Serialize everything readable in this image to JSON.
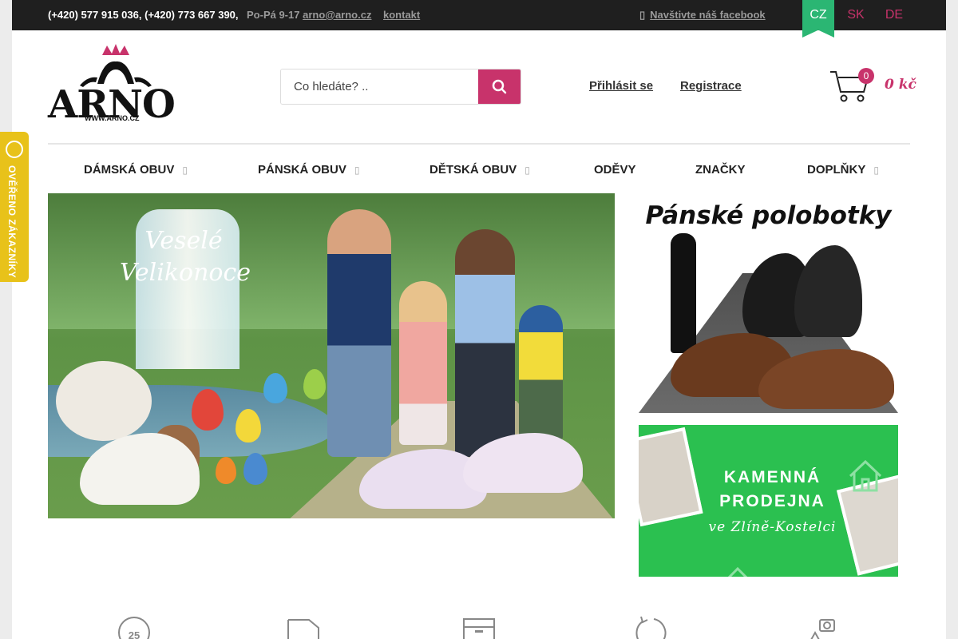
{
  "topbar": {
    "phones": "(+420) 577 915 036, (+420) 773 667 390,",
    "hours": "Po-Pá 9-17",
    "email": "arno@arno.cz",
    "contact": "kontakt",
    "facebook_icon": "facebook-icon",
    "facebook": "Navštivte náš facebook",
    "languages": [
      "CZ",
      "SK",
      "DE"
    ],
    "active_language": "CZ"
  },
  "header": {
    "logo_text": "ARNO",
    "logo_url": "WWW.ARNO.CZ",
    "search_placeholder": "Co hledáte? ..",
    "login": "Přihlásit se",
    "register": "Registrace",
    "cart_count": "0",
    "cart_total": "0 kč"
  },
  "nav": {
    "items": [
      {
        "label": "DÁMSKÁ OBUV",
        "has_submenu": true
      },
      {
        "label": "PÁNSKÁ OBUV",
        "has_submenu": true
      },
      {
        "label": "DĚTSKÁ OBUV",
        "has_submenu": true
      },
      {
        "label": "ODĚVY",
        "has_submenu": false
      },
      {
        "label": "ZNAČKY",
        "has_submenu": false
      },
      {
        "label": "DOPLŇKY",
        "has_submenu": true
      }
    ]
  },
  "banners": {
    "hero_text": "Veselé Velikonoce",
    "side1_title": "Pánské polobotky",
    "side2_line1": "KAMENNÁ",
    "side2_line2": "PRODEJNA",
    "side2_line3": "ve Zlíně-Kostelci"
  },
  "badge": {
    "text": "OVĚŘENO ZÁKAZNÍKY"
  },
  "benefits": {
    "icons": [
      "clock-25-icon",
      "truck-icon",
      "box-icon",
      "return-icon",
      "camera-icon"
    ]
  },
  "colors": {
    "accent": "#c8336b",
    "topbar_bg": "#1f1f1f",
    "lang_active": "#2bb673",
    "store_banner": "#2bc050",
    "badge": "#e8c21a"
  }
}
